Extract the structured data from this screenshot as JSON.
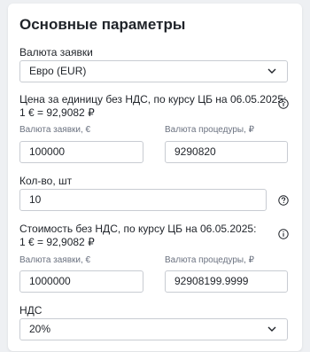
{
  "section": {
    "title": "Основные параметры"
  },
  "currency": {
    "label": "Валюта заявки",
    "selected": "Евро (EUR)"
  },
  "unit_price": {
    "info_line1": "Цена за единицу без НДС, по курсу ЦБ на 06.05.2025:",
    "info_line2": "1 € = 92,9082 ₽",
    "bid_currency_label": "Валюта заявки, €",
    "bid_currency_value": "100000",
    "procedure_currency_label": "Валюта процедуры, ₽",
    "procedure_currency_value": "9290820"
  },
  "quantity": {
    "label": "Кол-во, шт",
    "value": "10"
  },
  "total_cost": {
    "info_line1": "Стоимость без НДС, по курсу ЦБ на 06.05.2025:",
    "info_line2": "1 € = 92,9082 ₽",
    "bid_currency_label": "Валюта заявки, €",
    "bid_currency_value": "1000000",
    "procedure_currency_label": "Валюта процедуры, ₽",
    "procedure_currency_value": "92908199.9999"
  },
  "vat": {
    "label": "НДС",
    "selected": "20%"
  },
  "icons": {
    "info": "info-circle-icon",
    "help": "question-circle-icon",
    "dropdown": "chevron-down-icon"
  },
  "colors": {
    "background": "#eef0f3",
    "card": "#ffffff",
    "border": "#c8ccd2",
    "muted_text": "#6b7280"
  }
}
